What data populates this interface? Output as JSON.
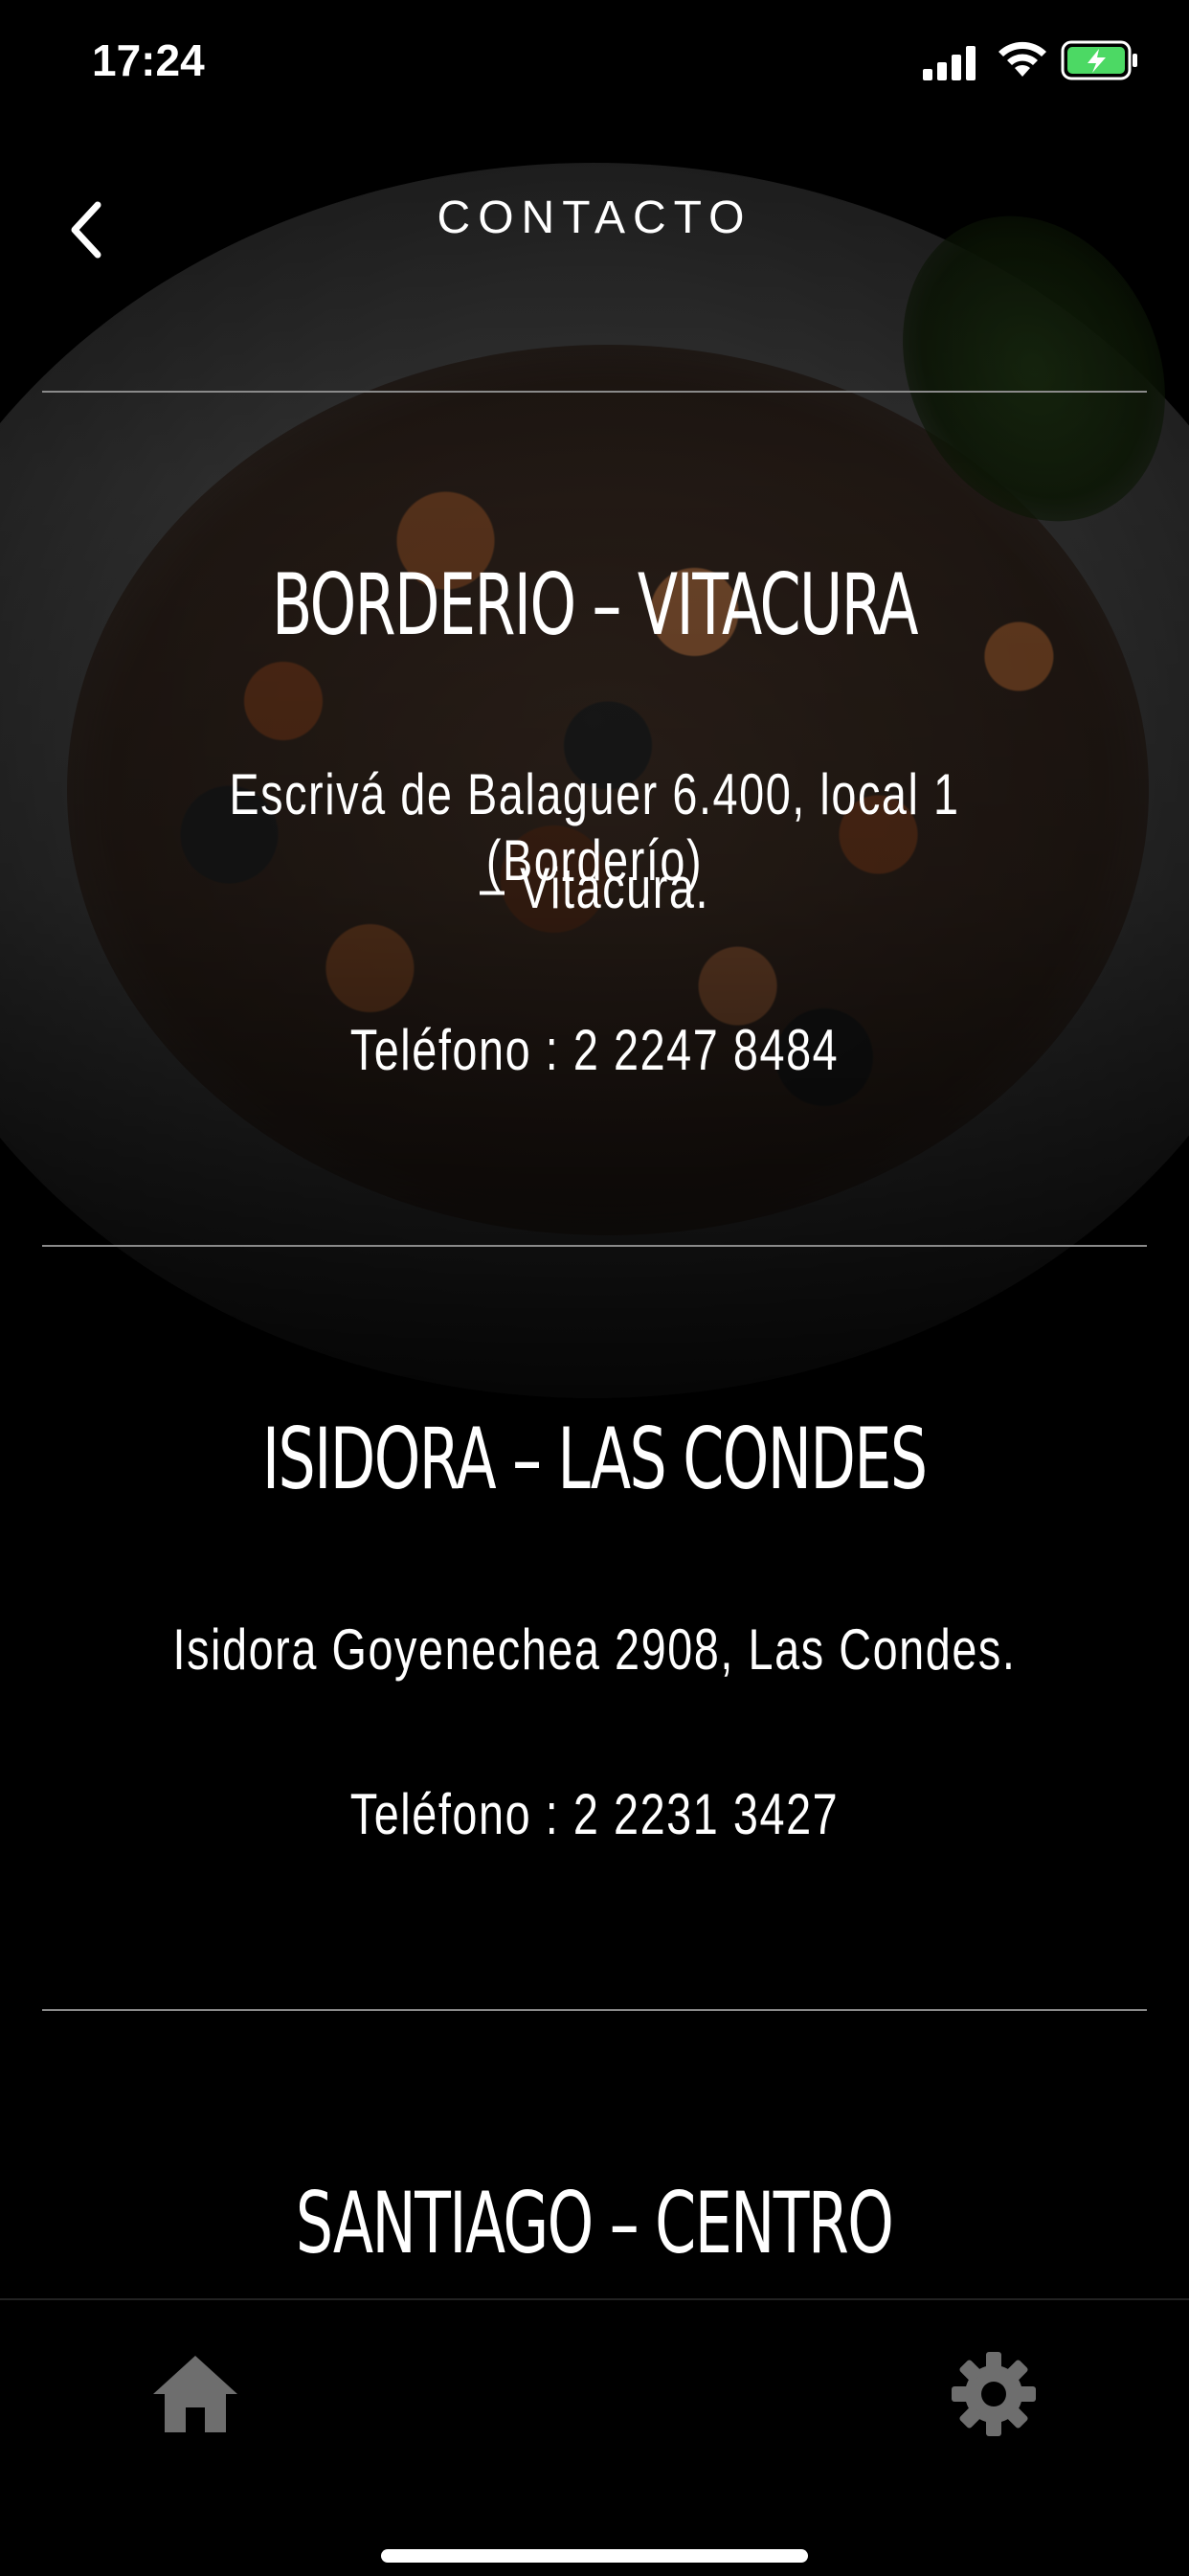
{
  "status_bar": {
    "time": "17:24"
  },
  "header": {
    "title": "CONTACTO"
  },
  "locations": [
    {
      "title": "BORDERIO – VITACURA",
      "address_line1": "Escrivá de Balaguer 6.400, local 1 (Borderío)",
      "address_line2": "– Vitacura.",
      "phone": "Teléfono : 2 2247 8484"
    },
    {
      "title": "ISIDORA – LAS CONDES",
      "address_line1": "Isidora Goyenechea 2908, Las Condes.",
      "phone": "Teléfono : 2 2231 3427"
    },
    {
      "title": "SANTIAGO – CENTRO"
    }
  ],
  "tab_bar": {
    "items": [
      "home-icon",
      "gear-icon"
    ]
  }
}
